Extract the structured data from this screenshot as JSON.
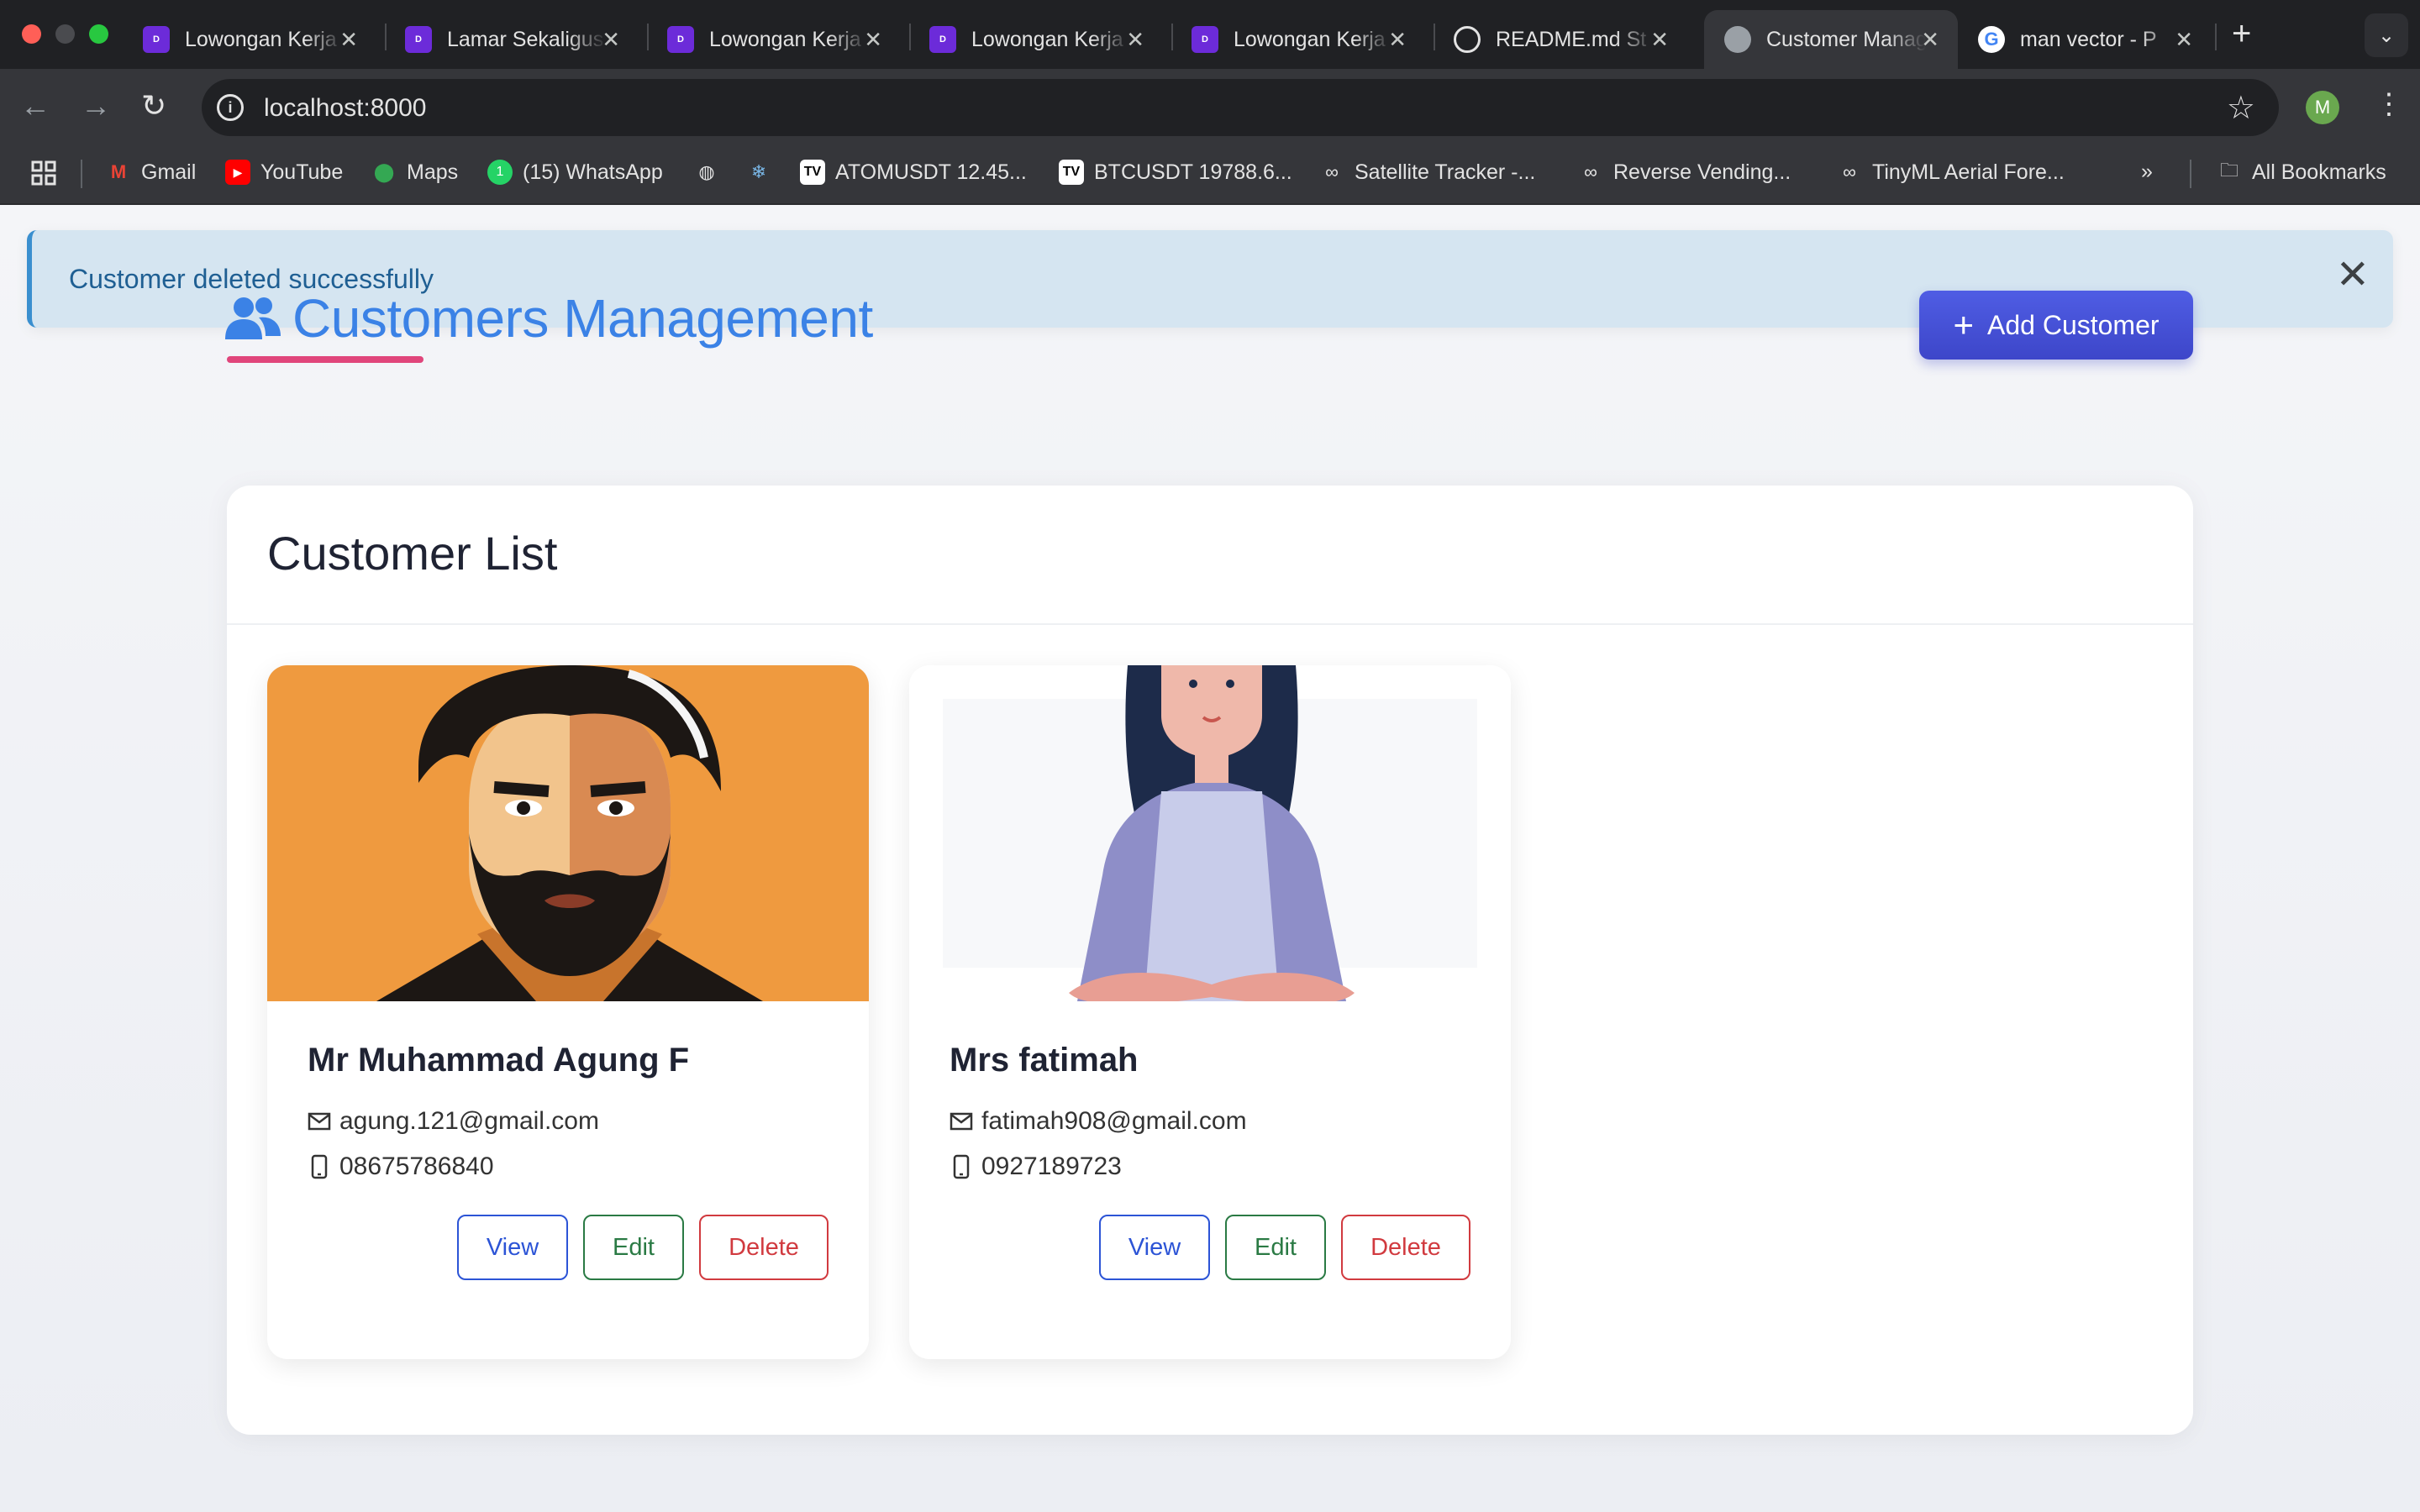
{
  "browser": {
    "tabs": [
      {
        "title": "Lowongan Kerja",
        "favicon": "dealls-icon",
        "color": "#6c2bd9"
      },
      {
        "title": "Lamar Sekaligus",
        "favicon": "dealls-icon",
        "color": "#6c2bd9"
      },
      {
        "title": "Lowongan Kerja",
        "favicon": "dealls-icon",
        "color": "#6c2bd9"
      },
      {
        "title": "Lowongan Kerja",
        "favicon": "dealls-icon",
        "color": "#6c2bd9"
      },
      {
        "title": "Lowongan Kerja",
        "favicon": "dealls-icon",
        "color": "#6c2bd9"
      },
      {
        "title": "README.md St",
        "favicon": "openai-icon",
        "color": "#ffffff"
      },
      {
        "title": "Customer Management",
        "favicon": "globe-icon",
        "color": "#9aa0a6",
        "active": true
      },
      {
        "title": "man vector - P",
        "favicon": "google-icon",
        "color": "#ffffff"
      }
    ],
    "url": "localhost:8000",
    "profile_initial": "M",
    "bookmarks": [
      {
        "label": "Gmail",
        "icon": "gmail-icon"
      },
      {
        "label": "YouTube",
        "icon": "youtube-icon"
      },
      {
        "label": "Maps",
        "icon": "maps-icon"
      },
      {
        "label": "(15) WhatsApp",
        "icon": "whatsapp-icon"
      },
      {
        "label": "",
        "icon": "globe-icon"
      },
      {
        "label": "",
        "icon": "snowflake-icon"
      },
      {
        "label": "ATOMUSDT 12.45...",
        "icon": "tradingview-icon"
      },
      {
        "label": "BTCUSDT 19788.6...",
        "icon": "tradingview-icon"
      },
      {
        "label": "Satellite Tracker -...",
        "icon": "link-icon"
      },
      {
        "label": "Reverse Vending...",
        "icon": "link-icon"
      },
      {
        "label": "TinyML Aerial Fore...",
        "icon": "link-icon"
      }
    ],
    "all_bookmarks": "All Bookmarks"
  },
  "alert": {
    "message": "Customer deleted successfully"
  },
  "header": {
    "title": "Customers Management",
    "add_button": "Add Customer"
  },
  "list": {
    "title": "Customer List",
    "customers": [
      {
        "name": "Mr Muhammad Agung F",
        "email": "agung.121@gmail.com",
        "phone": "08675786840",
        "photo": "bearded-man-portrait"
      },
      {
        "name": "Mrs fatimah",
        "email": "fatimah908@gmail.com",
        "phone": "0927189723",
        "photo": "woman-illustration"
      }
    ],
    "actions": {
      "view": "View",
      "edit": "Edit",
      "delete": "Delete"
    }
  },
  "colors": {
    "accent": "#3b82e6",
    "underline": "#e0457b",
    "add_button": "#4650d8",
    "view": "#2c54d6",
    "edit": "#2a7a44",
    "delete": "#d13a3f",
    "alert_bg": "#cfe2f0"
  }
}
